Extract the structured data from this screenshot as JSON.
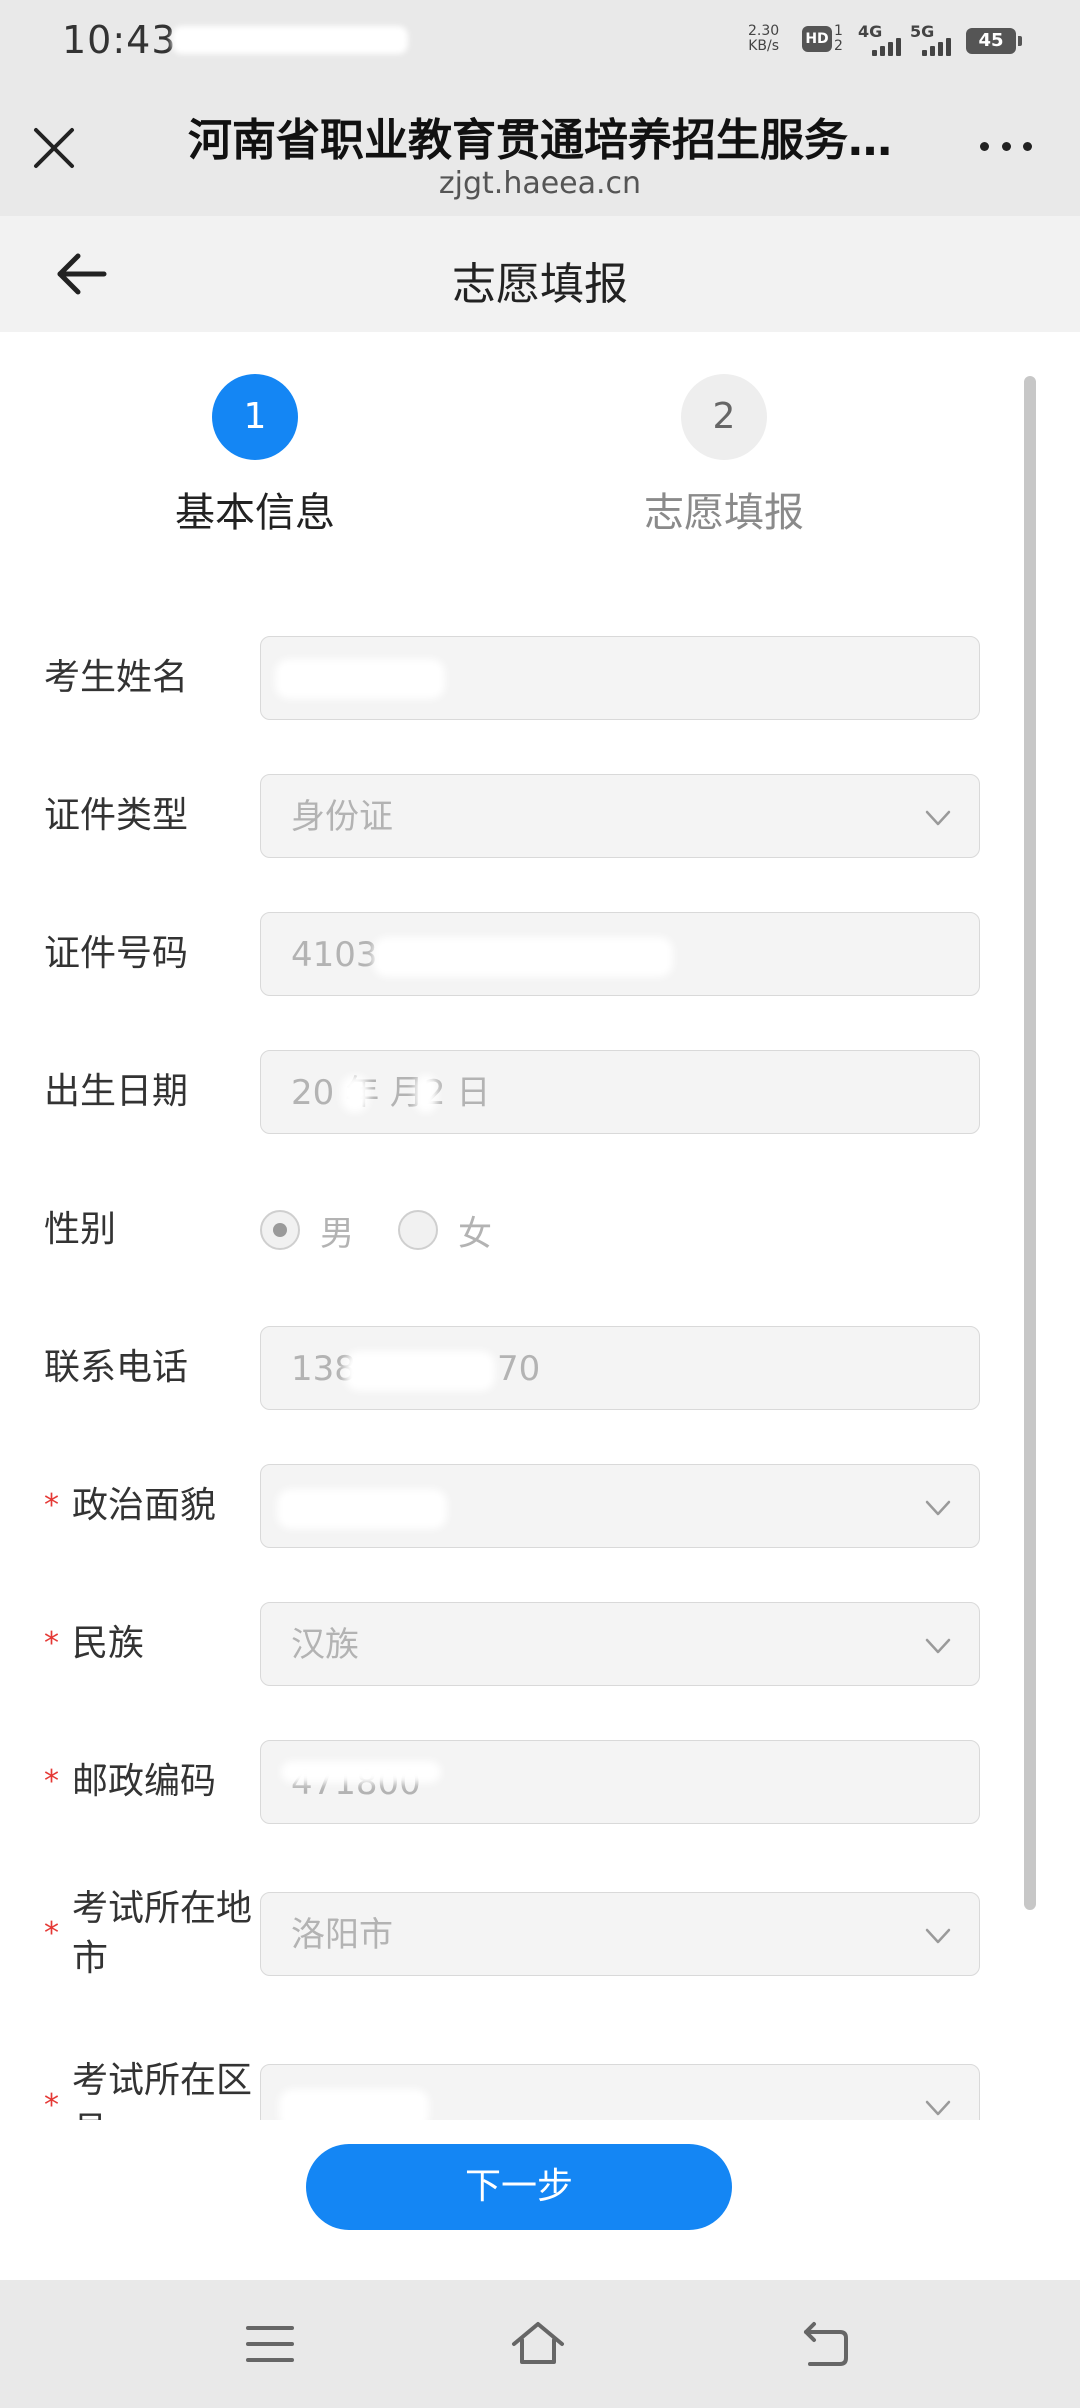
{
  "status_bar": {
    "time": "10:43",
    "net_speed_value": "2.30",
    "net_speed_unit": "KB/s",
    "hd_label": "HD",
    "hd_sub_top": "1",
    "hd_sub_bottom": "2",
    "network_1": "4G",
    "network_2": "5G",
    "battery": "45"
  },
  "browser": {
    "title": "河南省职业教育贯通培养招生服务…",
    "url": "zjgt.haeea.cn",
    "close_icon": "close-icon",
    "more_icon": "more-icon"
  },
  "header": {
    "title": "志愿填报",
    "back_icon": "back-arrow-icon"
  },
  "steps": [
    {
      "number": "1",
      "label": "基本信息",
      "active": true
    },
    {
      "number": "2",
      "label": "志愿填报",
      "active": false
    }
  ],
  "form": {
    "name": {
      "label": "考生姓名",
      "value": ""
    },
    "id_type": {
      "label": "证件类型",
      "value": "身份证"
    },
    "id_number": {
      "label": "证件号码",
      "value": "4103"
    },
    "birth_date": {
      "label": "出生日期",
      "value": "20  年  月2 日"
    },
    "gender": {
      "label": "性别",
      "options": [
        "男",
        "女"
      ],
      "selected": "男"
    },
    "phone": {
      "label": "联系电话",
      "value_prefix": "138",
      "value_suffix": "70"
    },
    "political_status": {
      "label": "政治面貌",
      "required": true,
      "value": ""
    },
    "ethnicity": {
      "label": "民族",
      "required": true,
      "value": "汉族"
    },
    "postal_code": {
      "label": "邮政编码",
      "required": true,
      "value": "471800"
    },
    "exam_city": {
      "label": "考试所在地市",
      "required": true,
      "value": "洛阳市"
    },
    "exam_district": {
      "label": "考试所在区县",
      "required": true,
      "value": ""
    },
    "required_mark": "*"
  },
  "next_button": {
    "label": "下一步"
  },
  "nav_bar": {
    "icons": [
      "menu-icon",
      "home-icon",
      "back-icon"
    ]
  },
  "colors": {
    "primary": "#1486f4",
    "required": "#e53935",
    "placeholder": "#b3b3b3"
  }
}
